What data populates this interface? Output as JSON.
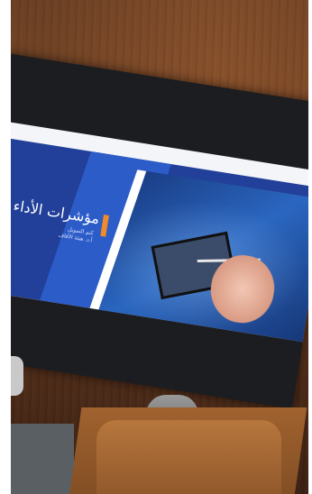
{
  "slide": {
    "title": "مؤشرات الأداء",
    "line1": "كتم التمويل",
    "line2": "أ.د. هيئة الأقاف"
  }
}
